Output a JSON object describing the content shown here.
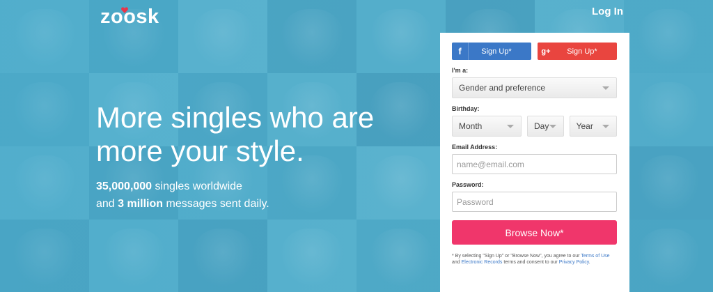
{
  "brand": {
    "logo_text": "zoosk"
  },
  "header": {
    "login_label": "Log In"
  },
  "hero": {
    "headline": "More singles who are more your style.",
    "stat1_num": "35,000,000",
    "stat1_text": " singles worldwide",
    "stat2_pre": "and ",
    "stat2_num": "3 million",
    "stat2_text": " messages sent daily."
  },
  "signup": {
    "facebook_label": "Sign Up*",
    "facebook_icon": "f",
    "google_label": "Sign Up*",
    "google_icon": "g+",
    "im_a_label": "I'm a:",
    "gender_value": "Gender and preference",
    "birthday_label": "Birthday:",
    "month_value": "Month",
    "day_value": "Day",
    "year_value": "Year",
    "email_label": "Email Address:",
    "email_placeholder": "name@email.com",
    "password_label": "Password:",
    "password_placeholder": "Password",
    "browse_label": "Browse Now*",
    "legal_1": "* By selecting \"Sign Up\" or \"Browse Now\", you agree to our ",
    "legal_terms": "Terms of Use",
    "legal_2": " and ",
    "legal_records": "Electronic Records",
    "legal_3": " terms and consent to our ",
    "legal_privacy": "Privacy Policy",
    "legal_4": "."
  },
  "colors": {
    "facebook": "#3b78c7",
    "google": "#e9453f",
    "browse": "#f0366b",
    "background": "#5aaec8"
  }
}
